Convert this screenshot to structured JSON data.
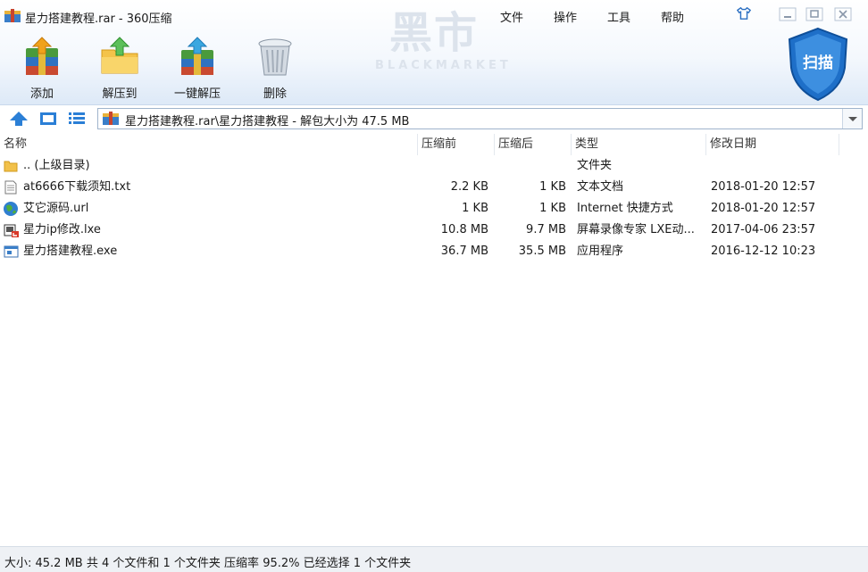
{
  "window": {
    "title": "星力搭建教程.rar - 360压缩",
    "menu": [
      "文件",
      "操作",
      "工具",
      "帮助"
    ],
    "watermark_main": "黑市",
    "watermark_sub": "BLACKMARKET"
  },
  "toolbar": [
    {
      "label": "添加",
      "icon": "add-archive-icon"
    },
    {
      "label": "解压到",
      "icon": "extract-to-icon"
    },
    {
      "label": "一键解压",
      "icon": "one-click-extract-icon"
    },
    {
      "label": "删除",
      "icon": "trash-icon"
    }
  ],
  "scan": {
    "label": "扫描"
  },
  "address": {
    "path": "星力搭建教程.rar\\星力搭建教程 - 解包大小为 47.5 MB"
  },
  "columns": [
    "名称",
    "压缩前",
    "压缩后",
    "类型",
    "修改日期"
  ],
  "files": [
    {
      "name": ".. (上级目录)",
      "size": "",
      "packed": "",
      "type": "文件夹",
      "date": "",
      "icon": "folder-icon"
    },
    {
      "name": "at6666下载须知.txt",
      "size": "2.2 KB",
      "packed": "1 KB",
      "type": "文本文档",
      "date": "2018-01-20 12:57",
      "icon": "text-file-icon"
    },
    {
      "name": "艾它源码.url",
      "size": "1 KB",
      "packed": "1 KB",
      "type": "Internet 快捷方式",
      "date": "2018-01-20 12:57",
      "icon": "globe-icon"
    },
    {
      "name": "星力ip修改.lxe",
      "size": "10.8 MB",
      "packed": "9.7 MB",
      "type": "屏幕录像专家 LXE动...",
      "date": "2017-04-06 23:57",
      "icon": "recording-file-icon"
    },
    {
      "name": "星力搭建教程.exe",
      "size": "36.7 MB",
      "packed": "35.5 MB",
      "type": "应用程序",
      "date": "2016-12-12 10:23",
      "icon": "exe-file-icon"
    }
  ],
  "status": "大小: 45.2 MB 共 4 个文件和 1 个文件夹 压缩率 95.2% 已经选择 1 个文件夹",
  "colors": {
    "accent": "#2b7fd6",
    "header_gradient_end": "#dde9f7",
    "scan_shield": "#1e6fc8"
  }
}
